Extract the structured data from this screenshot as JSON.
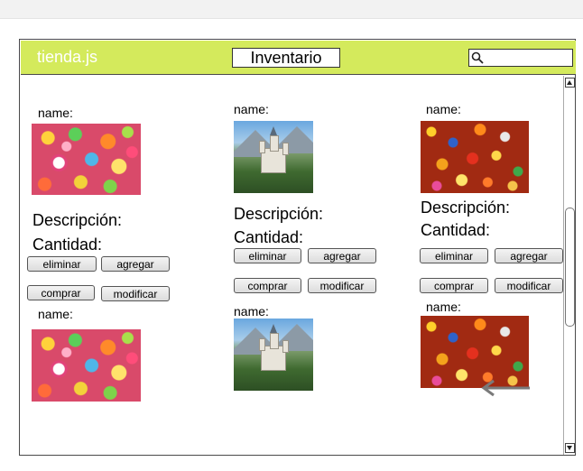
{
  "app": {
    "brand": "tienda.js",
    "title": "Inventario"
  },
  "search": {
    "placeholder": ""
  },
  "labels": {
    "name": "name:",
    "descripcion": "Descripción:",
    "cantidad": "Cantidad:",
    "eliminar": "eliminar",
    "agregar": "agregar",
    "comprar": "comprar",
    "modificar": "modificar"
  },
  "products": [
    {
      "image": "candy-lollipops"
    },
    {
      "image": "castle"
    },
    {
      "image": "candy-corn"
    },
    {
      "image": "candy-lollipops"
    },
    {
      "image": "castle"
    },
    {
      "image": "candy-corn"
    }
  ],
  "icons": {
    "search": "search-icon",
    "back": "arrow-left-icon"
  },
  "colors": {
    "header": "#d4ea5c",
    "brand_text": "#ffffff"
  }
}
